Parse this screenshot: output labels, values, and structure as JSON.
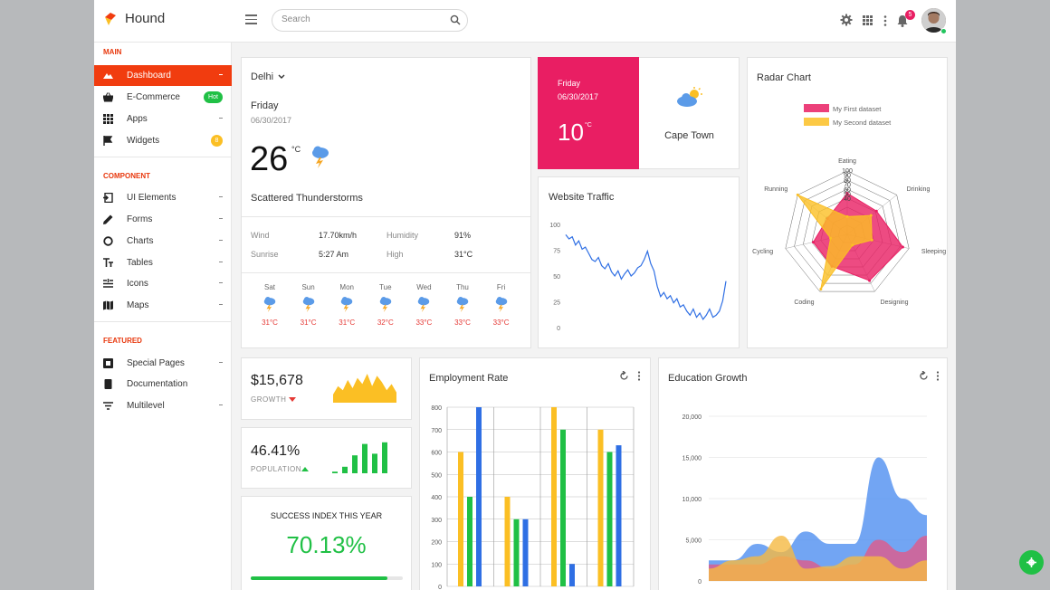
{
  "app": {
    "name": "Hound"
  },
  "search": {
    "placeholder": "Search"
  },
  "header": {
    "notification_count": "5"
  },
  "sidebar": {
    "sections": {
      "main": "MAIN",
      "component": "COMPONENT",
      "featured": "FEATURED"
    },
    "main_items": [
      {
        "label": "Dashboard",
        "icon": "dashboard-icon"
      },
      {
        "label": "E-Commerce",
        "icon": "basket-icon",
        "badge": "Hot"
      },
      {
        "label": "Apps",
        "icon": "apps-grid-icon"
      },
      {
        "label": "Widgets",
        "icon": "flag-icon",
        "badge": "8"
      }
    ],
    "component_items": [
      {
        "label": "UI Elements",
        "icon": "ui-elements-icon"
      },
      {
        "label": "Forms",
        "icon": "pencil-icon"
      },
      {
        "label": "Charts",
        "icon": "chart-ring-icon"
      },
      {
        "label": "Tables",
        "icon": "table-icon"
      },
      {
        "label": "Icons",
        "icon": "icons-icon"
      },
      {
        "label": "Maps",
        "icon": "map-icon"
      }
    ],
    "featured_items": [
      {
        "label": "Special Pages",
        "icon": "special-pages-icon"
      },
      {
        "label": "Documentation",
        "icon": "book-icon"
      },
      {
        "label": "Multilevel",
        "icon": "multilevel-icon"
      }
    ]
  },
  "weather": {
    "city": "Delhi",
    "day": "Friday",
    "date": "06/30/2017",
    "temp": "26",
    "unit": "°C",
    "condition": "Scattered Thunderstorms",
    "wind_label": "Wind",
    "wind": "17.70km/h",
    "humidity_label": "Humidity",
    "humidity": "91%",
    "sunrise_label": "Sunrise",
    "sunrise": "5:27 Am",
    "high_label": "High",
    "high": "31°C",
    "forecast": [
      {
        "day": "Sat",
        "temp": "31°C"
      },
      {
        "day": "Sun",
        "temp": "31°C"
      },
      {
        "day": "Mon",
        "temp": "31°C"
      },
      {
        "day": "Tue",
        "temp": "32°C"
      },
      {
        "day": "Wed",
        "temp": "33°C"
      },
      {
        "day": "Thu",
        "temp": "33°C"
      },
      {
        "day": "Fri",
        "temp": "33°C"
      }
    ]
  },
  "cape_town": {
    "day": "Friday",
    "date": "06/30/2017",
    "temp": "10",
    "unit": "°C",
    "city": "Cape Town",
    "accent": "#e91e63"
  },
  "traffic": {
    "title": "Website Traffic"
  },
  "radar": {
    "title": "Radar Chart"
  },
  "stats": {
    "growth_value": "$15,678",
    "growth_label": "GROWTH",
    "population_value": "46.41%",
    "population_label": "POPULATION",
    "success_title": "SUCCESS INDEX THIS YEAR",
    "success_value": "70.13%",
    "success_progress": 0.9
  },
  "employment": {
    "title": "Employment Rate"
  },
  "education": {
    "title": "Education Growth"
  },
  "colors": {
    "primary": "#f13c0f",
    "green": "#20c045",
    "pink": "#e91e63",
    "yellow": "#fbbf24",
    "blue": "#2f6fe4"
  },
  "chart_data": [
    {
      "type": "line",
      "title": "Website Traffic",
      "ylim": [
        0,
        100
      ],
      "yticks": [
        "0",
        "25",
        "50",
        "75",
        "100"
      ],
      "series": [
        {
          "values": [
            90,
            86,
            88,
            80,
            84,
            76,
            78,
            72,
            66,
            64,
            68,
            60,
            57,
            62,
            54,
            50,
            55,
            47,
            52,
            56,
            50,
            53,
            58,
            60,
            66,
            74,
            62,
            55,
            40,
            30,
            34,
            28,
            31,
            24,
            28,
            20,
            22,
            16,
            12,
            18,
            10,
            14,
            8,
            12,
            18,
            10,
            12,
            16,
            26,
            45
          ]
        }
      ]
    },
    {
      "type": "radar",
      "title": "Radar Chart",
      "categories": [
        "Eating",
        "Drinking",
        "Sleeping",
        "Designing",
        "Coding",
        "Cycling",
        "Running"
      ],
      "rticks": [
        "100",
        "90",
        "80",
        "70",
        "60",
        "50",
        "40"
      ],
      "series": [
        {
          "name": "My First dataset",
          "values": [
            65,
            59,
            90,
            81,
            56,
            55,
            40
          ],
          "color": "#e91e63"
        },
        {
          "name": "My Second dataset",
          "values": [
            28,
            48,
            40,
            19,
            96,
            27,
            100
          ],
          "color": "#fbbf24"
        }
      ]
    },
    {
      "type": "area",
      "title": "Growth",
      "series": [
        {
          "values": [
            20,
            40,
            30,
            55,
            35,
            60,
            45,
            70,
            40,
            65,
            50,
            30,
            45,
            25
          ]
        }
      ]
    },
    {
      "type": "bar",
      "title": "Population",
      "series": [
        {
          "values": [
            5,
            20,
            55,
            90,
            60,
            95
          ]
        }
      ]
    },
    {
      "type": "bar",
      "title": "Employment Rate",
      "ylim": [
        0,
        800
      ],
      "yticks": [
        "0",
        "100",
        "200",
        "300",
        "400",
        "500",
        "600",
        "700",
        "800"
      ],
      "series": [
        {
          "color": "#fbbf24",
          "values": [
            600,
            400,
            800,
            700
          ]
        },
        {
          "color": "#20c045",
          "values": [
            400,
            300,
            700,
            600
          ]
        },
        {
          "color": "#2f6fe4",
          "values": [
            800,
            300,
            100,
            630
          ]
        }
      ]
    },
    {
      "type": "area",
      "title": "Education Growth",
      "ylim": [
        0,
        20000
      ],
      "yticks": [
        "0",
        "5,000",
        "10,000",
        "15,000",
        "20,000"
      ],
      "series": [
        {
          "color": "#4f8ff0",
          "values": [
            2500,
            2500,
            4500,
            3500,
            6000,
            4500,
            4500,
            15000,
            10000,
            8000
          ]
        },
        {
          "color": "#e05a8a",
          "values": [
            2000,
            2000,
            2000,
            3000,
            2500,
            1500,
            2000,
            5000,
            3500,
            5500
          ]
        },
        {
          "color": "#f5b942",
          "values": [
            1500,
            2500,
            3000,
            5500,
            1500,
            1800,
            3000,
            3000,
            1500,
            2500
          ]
        }
      ]
    }
  ]
}
